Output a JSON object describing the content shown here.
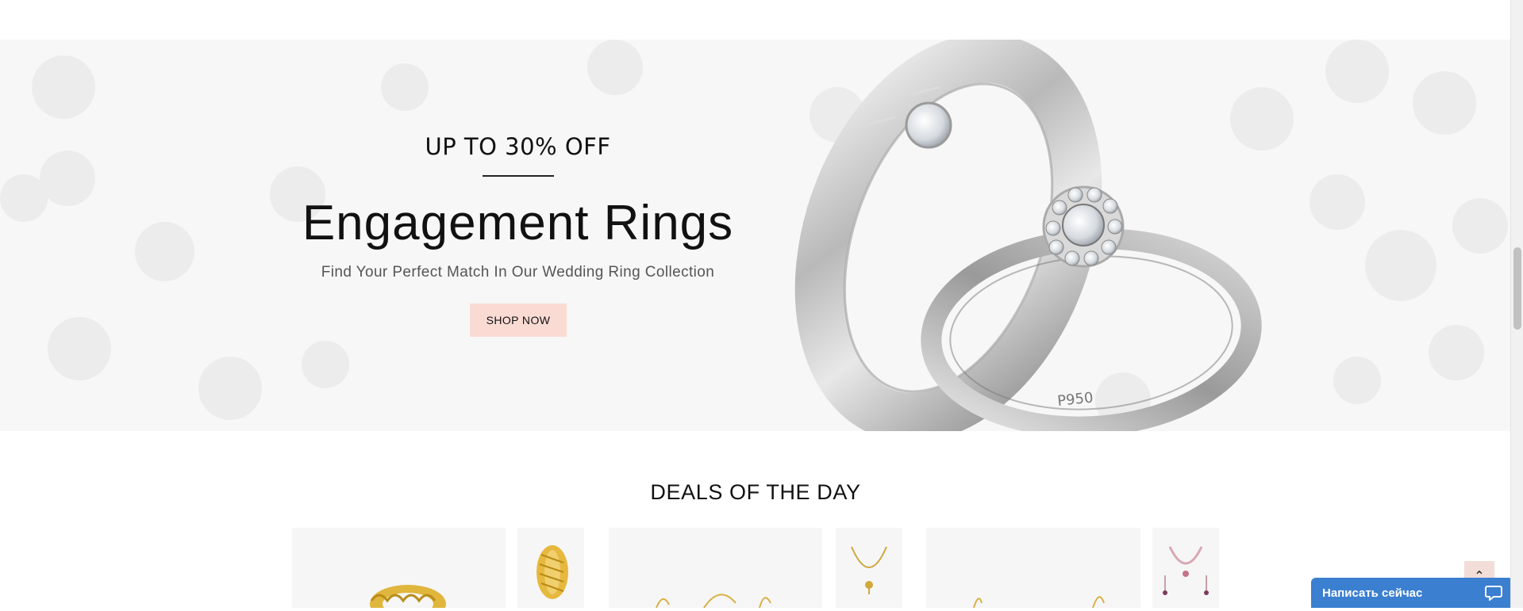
{
  "hero": {
    "kicker": "UP TO 30% OFF",
    "title": "Engagement Rings",
    "subtitle": "Find Your Perfect Match In Our Wedding Ring Collection",
    "cta_label": "SHOP NOW",
    "ring_engraving": "P950",
    "background_color": "#f7f7f7",
    "cta_color": "#fadbd4"
  },
  "deals": {
    "title": "DEALS OF THE DAY"
  },
  "back_to_top": {
    "icon": "chevron-up-icon"
  },
  "chat_widget": {
    "label": "Написать сейчас",
    "icon": "chat-bubble-icon",
    "color": "#3b7fd0"
  }
}
